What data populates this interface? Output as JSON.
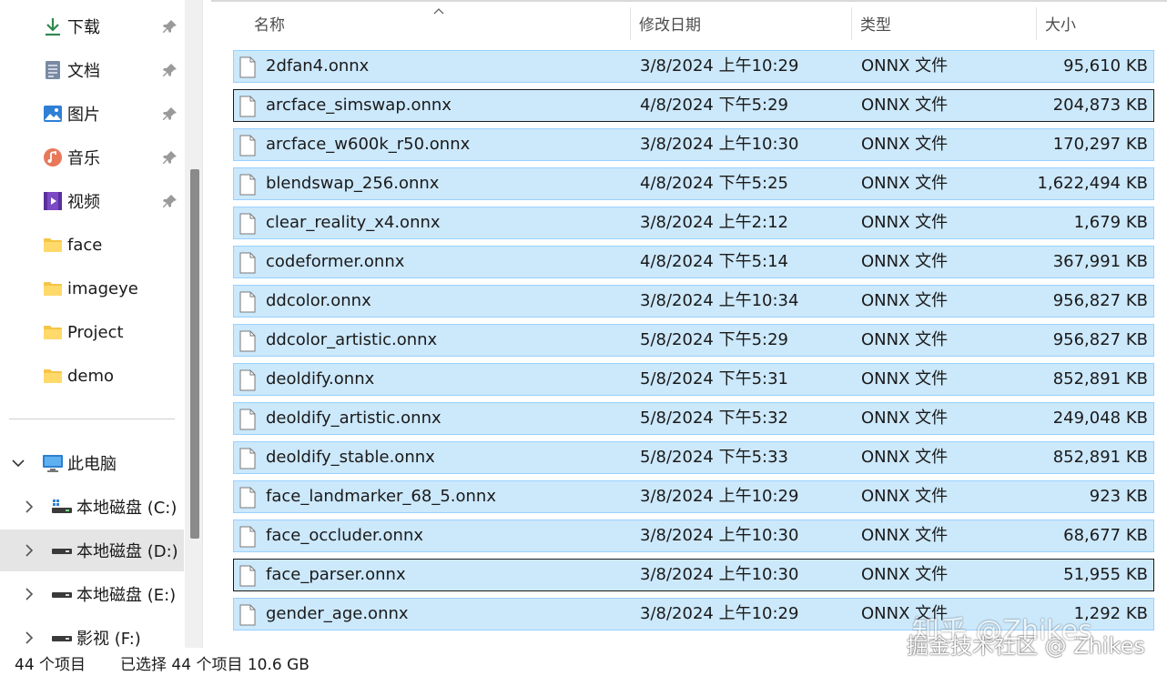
{
  "sidebar": {
    "quick_access": [
      {
        "label": "下载",
        "icon": "download-icon",
        "pinned": true
      },
      {
        "label": "文档",
        "icon": "documents-icon",
        "pinned": true
      },
      {
        "label": "图片",
        "icon": "pictures-icon",
        "pinned": true
      },
      {
        "label": "音乐",
        "icon": "music-icon",
        "pinned": true
      },
      {
        "label": "视频",
        "icon": "videos-icon",
        "pinned": true
      },
      {
        "label": "face",
        "icon": "folder-icon",
        "pinned": false
      },
      {
        "label": "imageye",
        "icon": "folder-icon",
        "pinned": false
      },
      {
        "label": "Project",
        "icon": "folder-icon",
        "pinned": false
      },
      {
        "label": "demo",
        "icon": "folder-icon",
        "pinned": false
      }
    ],
    "this_pc": {
      "label": "此电脑",
      "icon": "computer-icon",
      "expanded": true
    },
    "drives": [
      {
        "label": "本地磁盘 (C:)",
        "icon": "system-drive-icon",
        "selected": false
      },
      {
        "label": "本地磁盘 (D:)",
        "icon": "drive-icon",
        "selected": true
      },
      {
        "label": "本地磁盘 (E:)",
        "icon": "drive-icon",
        "selected": false
      },
      {
        "label": "影视 (F:)",
        "icon": "drive-icon",
        "selected": false
      }
    ]
  },
  "columns": {
    "name": "名称",
    "date": "修改日期",
    "type": "类型",
    "size": "大小"
  },
  "files": [
    {
      "name": "2dfan4.onnx",
      "date": "3/8/2024 上午10:29",
      "type": "ONNX 文件",
      "size": "95,610 KB",
      "focused": false
    },
    {
      "name": "arcface_simswap.onnx",
      "date": "4/8/2024 下午5:29",
      "type": "ONNX 文件",
      "size": "204,873 KB",
      "focused": true
    },
    {
      "name": "arcface_w600k_r50.onnx",
      "date": "3/8/2024 上午10:30",
      "type": "ONNX 文件",
      "size": "170,297 KB",
      "focused": false
    },
    {
      "name": "blendswap_256.onnx",
      "date": "4/8/2024 下午5:25",
      "type": "ONNX 文件",
      "size": "1,622,494 KB",
      "focused": false
    },
    {
      "name": "clear_reality_x4.onnx",
      "date": "3/8/2024 上午2:12",
      "type": "ONNX 文件",
      "size": "1,679 KB",
      "focused": false
    },
    {
      "name": "codeformer.onnx",
      "date": "4/8/2024 下午5:14",
      "type": "ONNX 文件",
      "size": "367,991 KB",
      "focused": false
    },
    {
      "name": "ddcolor.onnx",
      "date": "3/8/2024 上午10:34",
      "type": "ONNX 文件",
      "size": "956,827 KB",
      "focused": false
    },
    {
      "name": "ddcolor_artistic.onnx",
      "date": "5/8/2024 下午5:29",
      "type": "ONNX 文件",
      "size": "956,827 KB",
      "focused": false
    },
    {
      "name": "deoldify.onnx",
      "date": "5/8/2024 下午5:31",
      "type": "ONNX 文件",
      "size": "852,891 KB",
      "focused": false
    },
    {
      "name": "deoldify_artistic.onnx",
      "date": "5/8/2024 下午5:32",
      "type": "ONNX 文件",
      "size": "249,048 KB",
      "focused": false
    },
    {
      "name": "deoldify_stable.onnx",
      "date": "5/8/2024 下午5:33",
      "type": "ONNX 文件",
      "size": "852,891 KB",
      "focused": false
    },
    {
      "name": "face_landmarker_68_5.onnx",
      "date": "3/8/2024 上午10:29",
      "type": "ONNX 文件",
      "size": "923 KB",
      "focused": false
    },
    {
      "name": "face_occluder.onnx",
      "date": "3/8/2024 上午10:30",
      "type": "ONNX 文件",
      "size": "68,677 KB",
      "focused": false
    },
    {
      "name": "face_parser.onnx",
      "date": "3/8/2024 上午10:30",
      "type": "ONNX 文件",
      "size": "51,955 KB",
      "focused": true
    },
    {
      "name": "gender_age.onnx",
      "date": "3/8/2024 上午10:29",
      "type": "ONNX 文件",
      "size": "1,292 KB",
      "focused": false
    }
  ],
  "status": {
    "item_count": "44 个项目",
    "selection": "已选择 44 个项目  10.6 GB"
  },
  "watermark": {
    "line1": "知乎 @Zhikes",
    "line2": "掘金技术社区 @ Zhikes"
  },
  "colors": {
    "selection_fill": "#cce8fb",
    "selection_border": "#99d1ff",
    "focus_border": "#1a1a1a",
    "selected_nav": "#e5e5e5"
  }
}
